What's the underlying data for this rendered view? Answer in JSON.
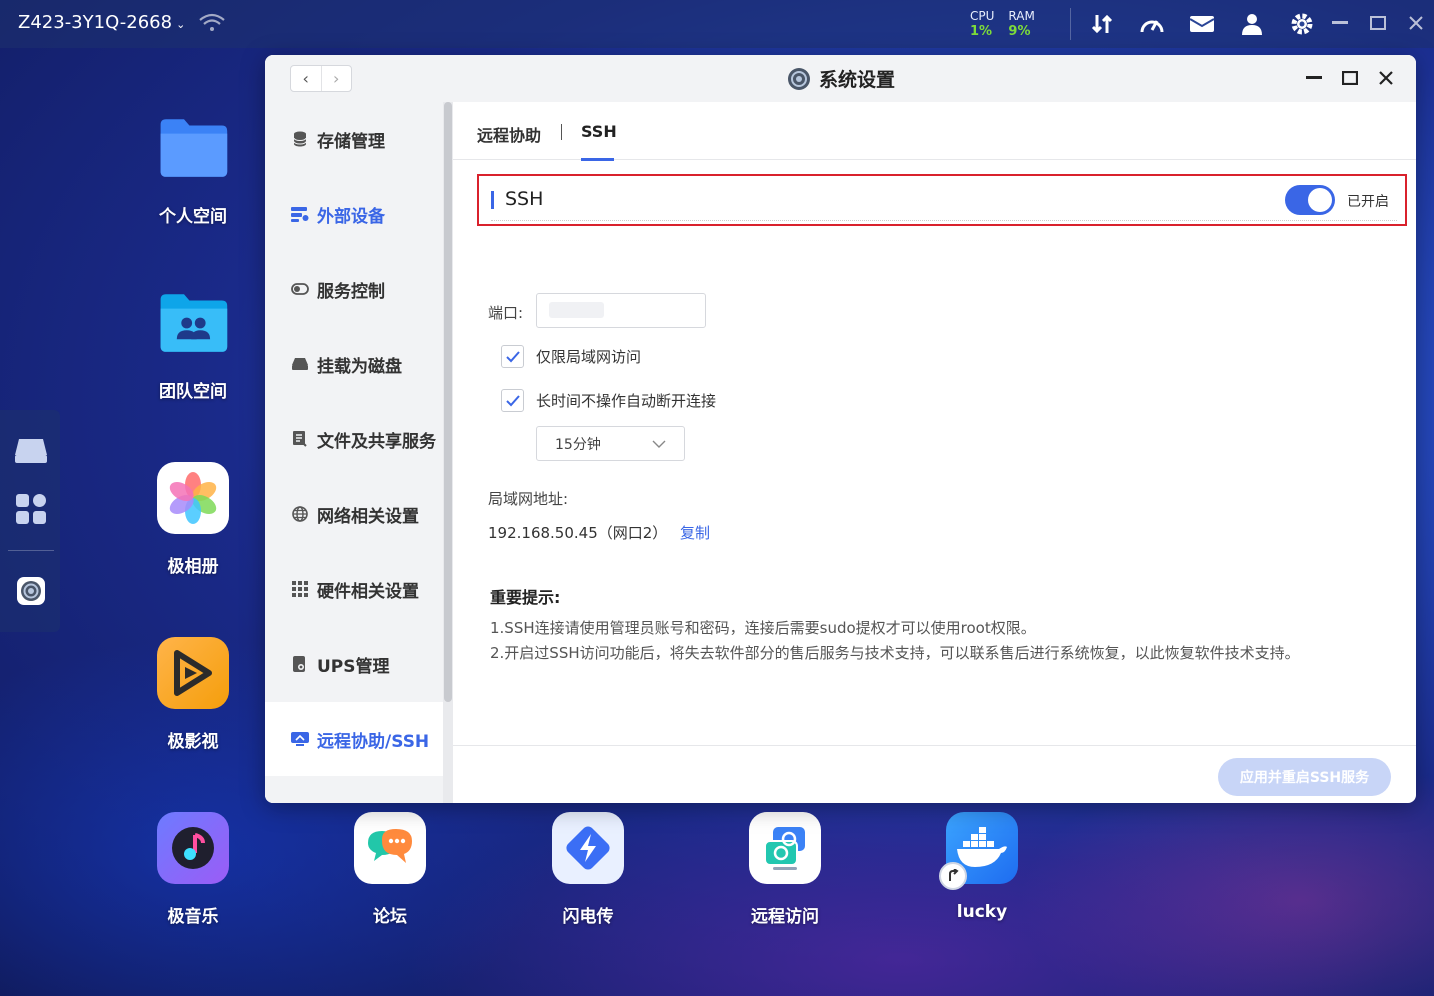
{
  "topbar": {
    "device_name": "Z423-3Y1Q-2668",
    "cpu_label": "CPU",
    "cpu_value": "1%",
    "ram_label": "RAM",
    "ram_value": "9%"
  },
  "desktop": {
    "icons": [
      {
        "label": "个人空间"
      },
      {
        "label": "团队空间"
      },
      {
        "label": "极相册"
      },
      {
        "label": "极影视"
      },
      {
        "label": "极音乐"
      },
      {
        "label": "论坛"
      },
      {
        "label": "闪电传"
      },
      {
        "label": "远程访问"
      },
      {
        "label": "lucky"
      }
    ]
  },
  "window": {
    "title": "系统设置",
    "sidebar": [
      {
        "label": "存储管理"
      },
      {
        "label": "外部设备"
      },
      {
        "label": "服务控制"
      },
      {
        "label": "挂载为磁盘"
      },
      {
        "label": "文件及共享服务"
      },
      {
        "label": "网络相关设置"
      },
      {
        "label": "硬件相关设置"
      },
      {
        "label": "UPS管理"
      },
      {
        "label": "远程协助/SSH"
      }
    ],
    "tabs": [
      {
        "label": "远程协助"
      },
      {
        "label": "SSH"
      }
    ],
    "ssh": {
      "label": "SSH",
      "status": "已开启",
      "enabled": true
    },
    "port_label": "端口:",
    "options": [
      {
        "label": "仅限局域网访问",
        "checked": true
      },
      {
        "label": "长时间不操作自动断开连接",
        "checked": true
      }
    ],
    "timeout_select": "15分钟",
    "lan_label": "局域网地址:",
    "lan_address": "192.168.50.45（网口2）",
    "copy_label": "复制",
    "tips_title": "重要提示:",
    "tips": [
      "1.SSH连接请使用管理员账号和密码，连接后需要sudo提权才可以使用root权限。",
      "2.开启过SSH访问功能后，将失去软件部分的售后服务与技术支持，可以联系售后进行系统恢复，以此恢复软件技术支持。"
    ],
    "apply_button": "应用并重启SSH服务"
  },
  "colors": {
    "accent": "#3a66e6",
    "highlight_border": "#d9212c",
    "stat_value": "#7ddc3a"
  }
}
